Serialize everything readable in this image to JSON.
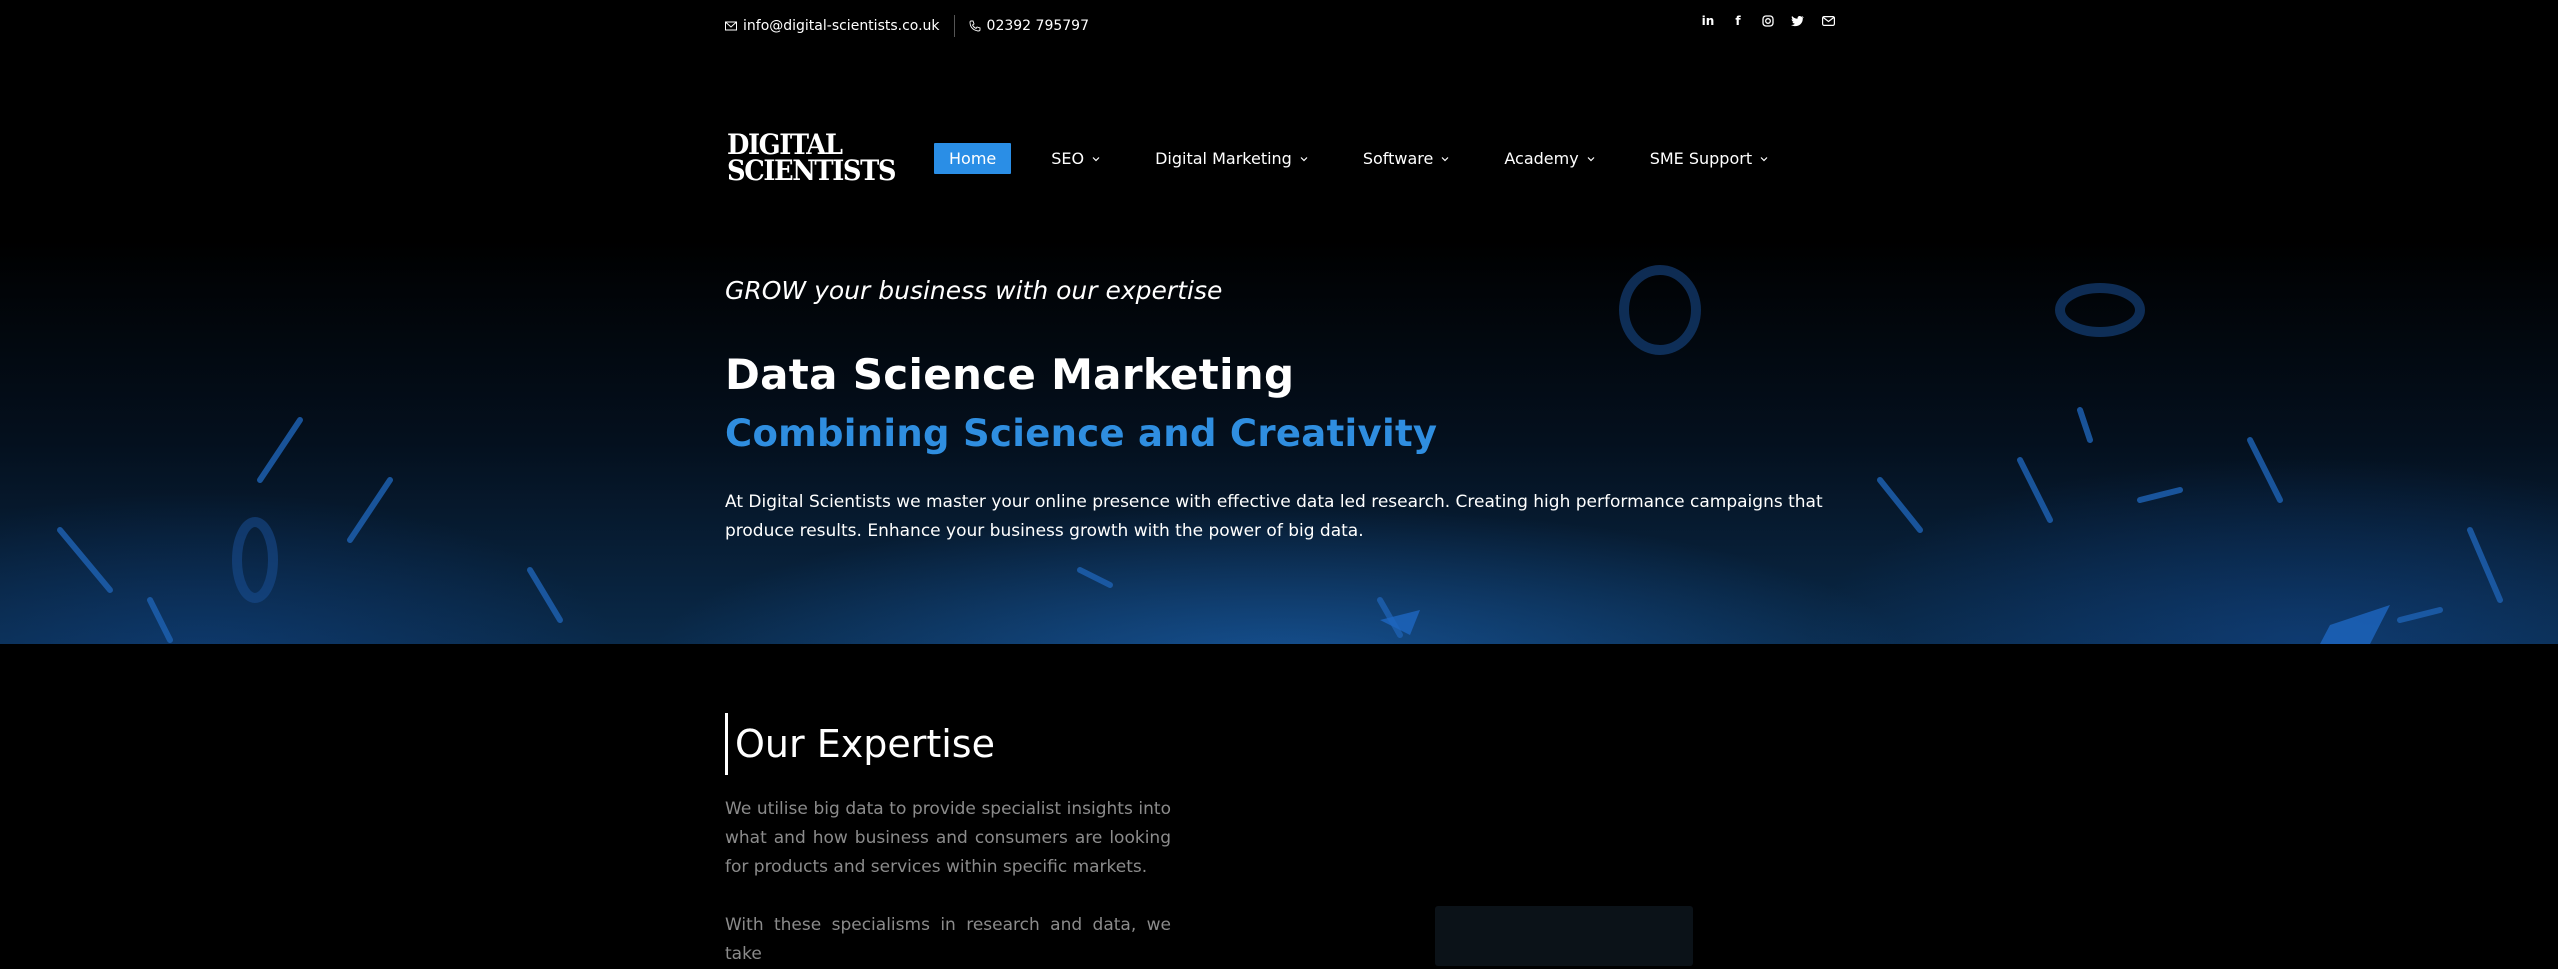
{
  "topbar": {
    "email": "info@digital-scientists.co.uk",
    "phone": "02392 795797",
    "social_icons": [
      "linkedin-icon",
      "facebook-icon",
      "instagram-icon",
      "twitter-icon",
      "mail-icon"
    ]
  },
  "logo": {
    "line1": "DIGITAL",
    "line2": "SCIENTISTS"
  },
  "nav": {
    "items": [
      {
        "label": "Home",
        "active": true
      },
      {
        "label": "SEO",
        "dropdown": true
      },
      {
        "label": "Digital Marketing",
        "dropdown": true
      },
      {
        "label": "Software",
        "dropdown": true
      },
      {
        "label": "Academy",
        "dropdown": true
      },
      {
        "label": "SME Support",
        "dropdown": true
      }
    ]
  },
  "hero": {
    "tagline": "GROW your business with our expertise",
    "title": "Data Science Marketing",
    "subtitle": "Combining Science and Creativity",
    "description": "At Digital Scientists we master your online presence with effective data led research.  Creating high performance campaigns that produce results. Enhance your business growth with the power of big data."
  },
  "expertise": {
    "title": "Our Expertise",
    "paragraph1": "We utilise big data to provide specialist insights into what and how business and consumers are looking for products and services within specific markets.",
    "paragraph2": "With these specialisms in research and data, we take"
  },
  "colors": {
    "accent": "#2a8ee6",
    "background": "#000000",
    "muted_text": "#8b8b8b"
  }
}
